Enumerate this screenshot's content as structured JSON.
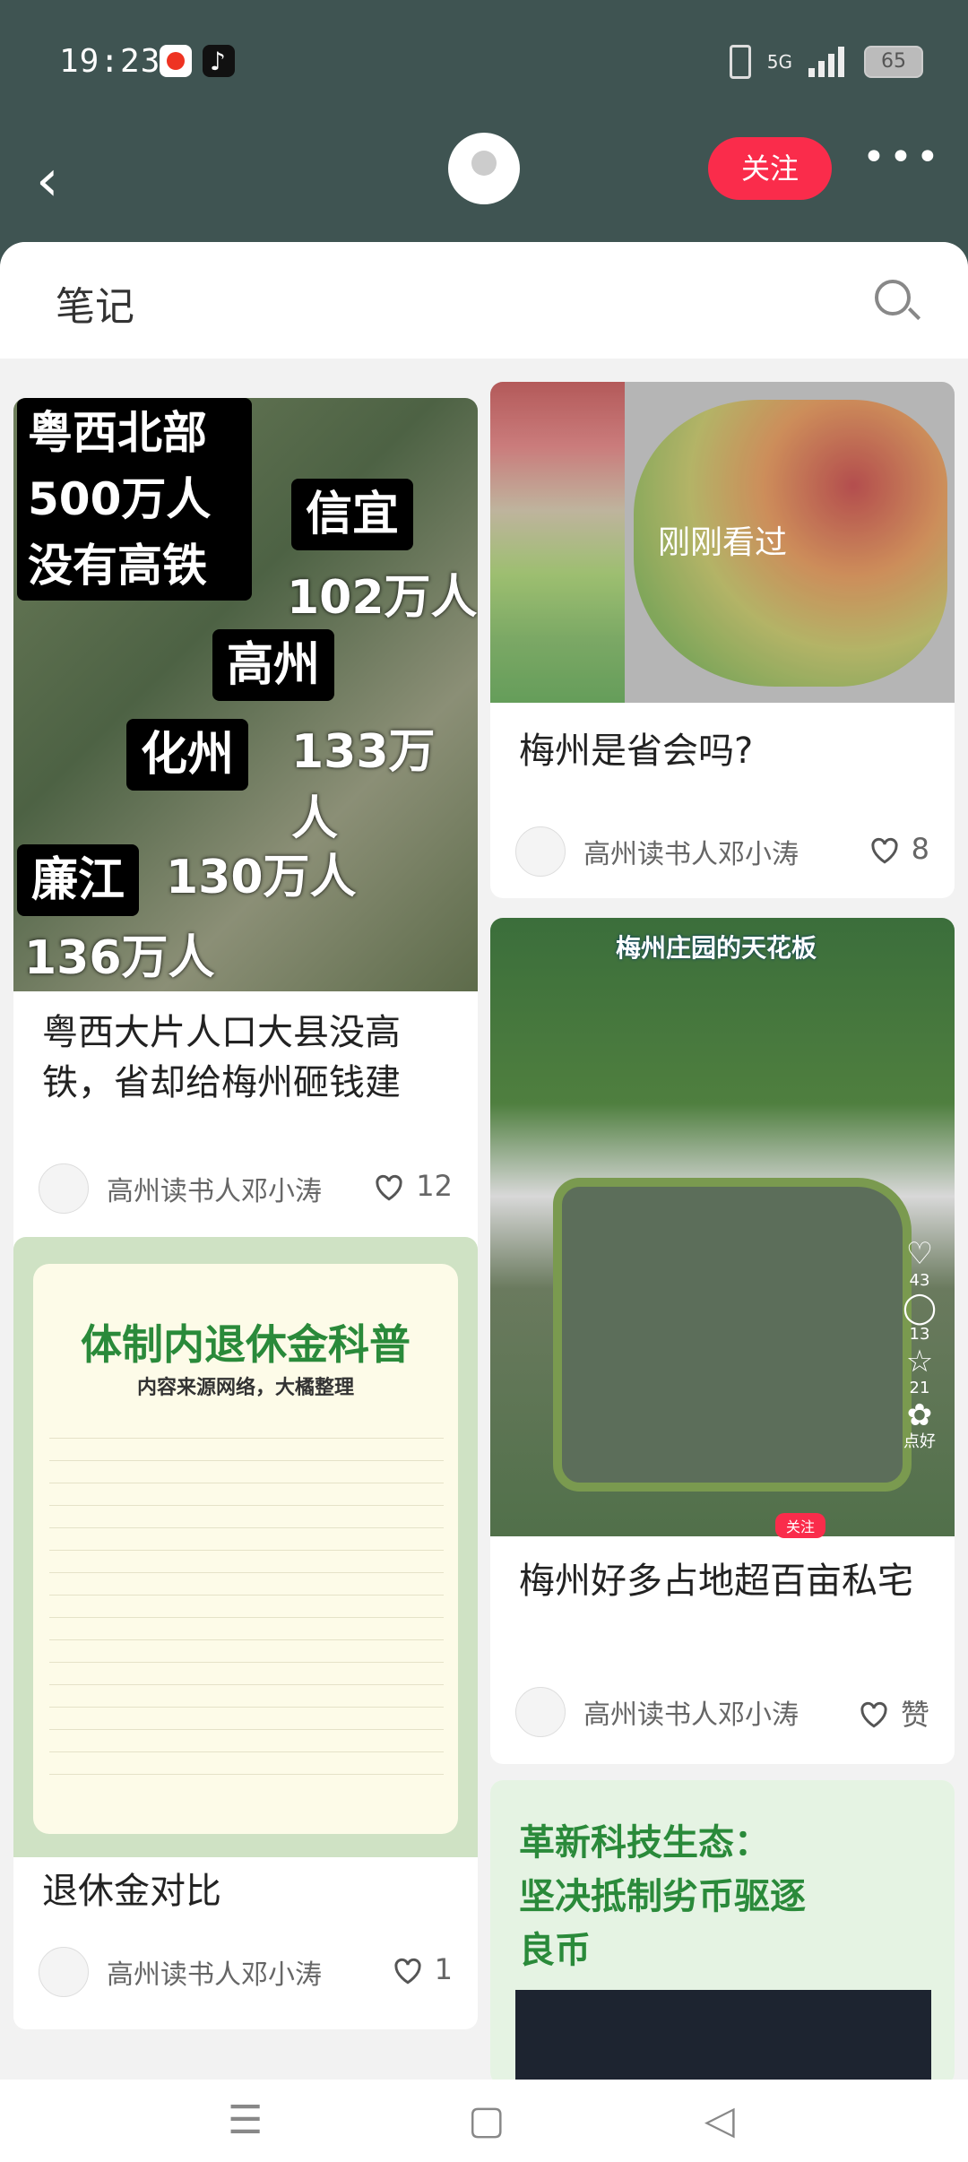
{
  "status": {
    "time": "19:23",
    "network": "5G",
    "battery": "65"
  },
  "header": {
    "follow_label": "关注"
  },
  "sheet": {
    "title": "笔记"
  },
  "cards": [
    {
      "title": "粤西大片人口大县没高铁，省却给梅州砸钱建",
      "author": "高州读书人邓小涛",
      "likes": "12",
      "cover_text": [
        "粤西北部",
        "500万人",
        "没有高铁",
        "信宜",
        "102万人",
        "高州",
        "133万人",
        "化州",
        "130万人",
        "廉江",
        "136万人"
      ]
    },
    {
      "title": "梅州是省会吗?",
      "author": "高州读书人邓小涛",
      "likes": "8",
      "cover_text": [
        "刚刚看过"
      ]
    },
    {
      "title": "退休金对比",
      "author": "高州读书人邓小涛",
      "likes": "1",
      "cover_text": [
        "体制内退休金科普",
        "内容来源网络，大橘整理"
      ]
    },
    {
      "title": "梅州好多占地超百亩私宅",
      "author": "高州读书人邓小涛",
      "likes": "赞",
      "cover_text": [
        "梅州庄园的天花板",
        "43",
        "13",
        "21",
        "点好",
        "关注"
      ]
    },
    {
      "cover_text": [
        "革新科技生态：",
        "坚决抵制劣币驱逐",
        "良币"
      ]
    }
  ]
}
